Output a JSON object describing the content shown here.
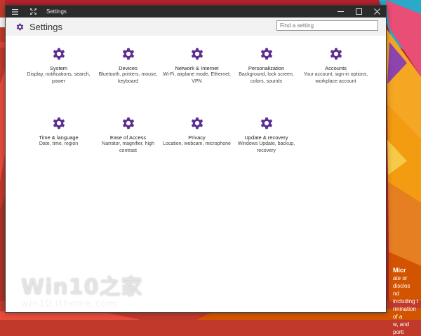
{
  "window": {
    "title": "Settings",
    "header_title": "Settings",
    "search_placeholder": "Find a setting",
    "menu_icon": "hamburger-icon",
    "expand_icon": "expand-icon",
    "controls": [
      "minimize-icon",
      "maximize-icon",
      "close-icon"
    ]
  },
  "categories": [
    {
      "name": "System",
      "desc": "Display, notifications, search, power"
    },
    {
      "name": "Devices",
      "desc": "Bluetooth, printers, mouse, keyboard"
    },
    {
      "name": "Network & Internet",
      "desc": "Wi-Fi, airplane mode, Ethernet, VPN"
    },
    {
      "name": "Personalization",
      "desc": "Background, lock screen, colors, sounds"
    },
    {
      "name": "Accounts",
      "desc": "Your account, sign-in options, workplace account"
    },
    {
      "name": "Time & language",
      "desc": "Date, time, region"
    },
    {
      "name": "Ease of Access",
      "desc": "Narrator, magnifier, high contrast"
    },
    {
      "name": "Privacy",
      "desc": "Location, webcam, microphone"
    },
    {
      "name": "Update & recovery",
      "desc": "Windows Update, backup, recovery"
    }
  ],
  "watermark": {
    "main": "Win10之家",
    "sub": "win10.ithome.com"
  },
  "desktop_text": {
    "heading": "Micr",
    "lines": [
      "ate or disclos",
      "nd including t",
      "rmination of a",
      "w, and porti"
    ]
  },
  "colors": {
    "accent": "#5c2d91",
    "titlebar": "#2b2b2b",
    "header_bg": "#f2f2f2"
  }
}
